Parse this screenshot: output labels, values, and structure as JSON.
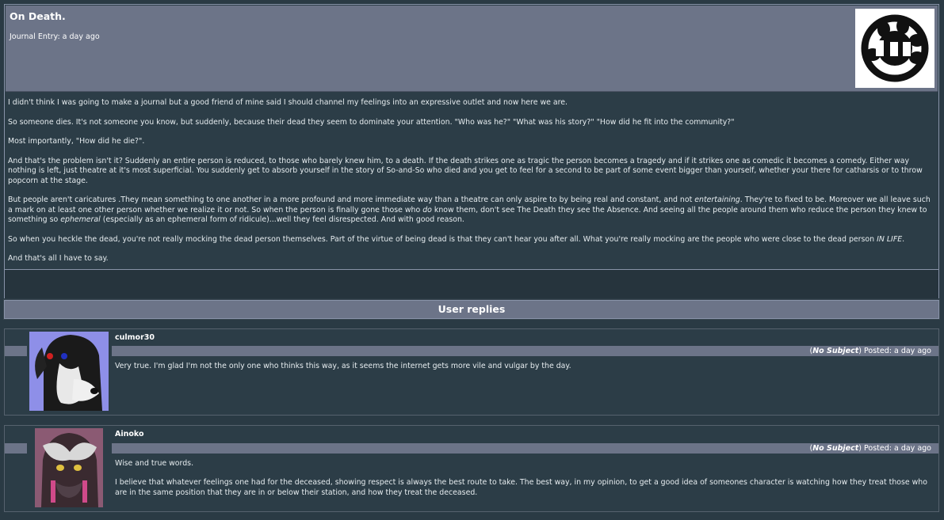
{
  "journal": {
    "title": "On Death.",
    "meta": "Journal Entry: a day ago",
    "paragraphs": [
      [
        "I didn't think I was going to make a journal but a good friend of mine said I should channel my feelings into an expressive outlet and now here we are."
      ],
      [
        "So someone dies. It's not someone you know, but suddenly, because their dead they seem to dominate your attention. \"Who was he?\" \"What was his story?\" \"How did he fit into the community?\""
      ],
      [
        "Most importantly, \"How did he die?\"."
      ],
      [
        "And that's the problem isn't it? Suddenly an entire person is reduced, to those who barely knew him, to a death. If the death strikes one as tragic the person becomes a tragedy and if it strikes one as comedic it becomes a comedy. Either way nothing is left, just theatre at it's most superficial. You suddenly get to absorb yourself in the story of So-and-So who died and you get to feel for a second to be part of some event bigger than yourself, whether your there for catharsis or to throw popcorn at the stage."
      ],
      [
        "But people aren't caricatures .They mean something to one another in a more profound and more immediate way than a theatre can only aspire to by being real and constant, and not ",
        {
          "em": "entertaining"
        },
        ". They're to fixed to be. Moreover we all leave such a mark on at least one other person whether we realize it or not. So when the person is finally gone those who ",
        {
          "em": "do"
        },
        " know them, don't see The Death they see the Absence. And seeing all the people around them who reduce the person they knew to something so ",
        {
          "em": "ephemeral"
        },
        " (especially as an ephemeral form of ridicule)...well they feel disrespected. And with good reason."
      ],
      [
        "So when you heckle the dead, you're not really mocking the dead person themselves. Part of the virtue of being dead is that they can't hear you after all. What you're really mocking are the people who were close to the dead person ",
        {
          "em": "IN LIFE"
        },
        "."
      ],
      [
        "And that's all I have to say."
      ]
    ]
  },
  "replies_header": "User replies",
  "replies": [
    {
      "username": "culmor30",
      "subject": "No Subject",
      "posted": "Posted: a day ago",
      "body": [
        "Very true. I'm glad I'm not the only one who thinks this way, as it seems the internet gets more vile and vulgar by the day."
      ]
    },
    {
      "username": "Ainoko",
      "subject": "No Subject",
      "posted": "Posted: a day ago",
      "body": [
        "Wise and true words.",
        "I believe that whatever feelings one had for the deceased, showing respect is always the best route to take. The best way, in my opinion, to get a good idea of someones character is watching how they treat those who are in the same position that they are in or below their station, and how they treat the deceased."
      ]
    }
  ]
}
